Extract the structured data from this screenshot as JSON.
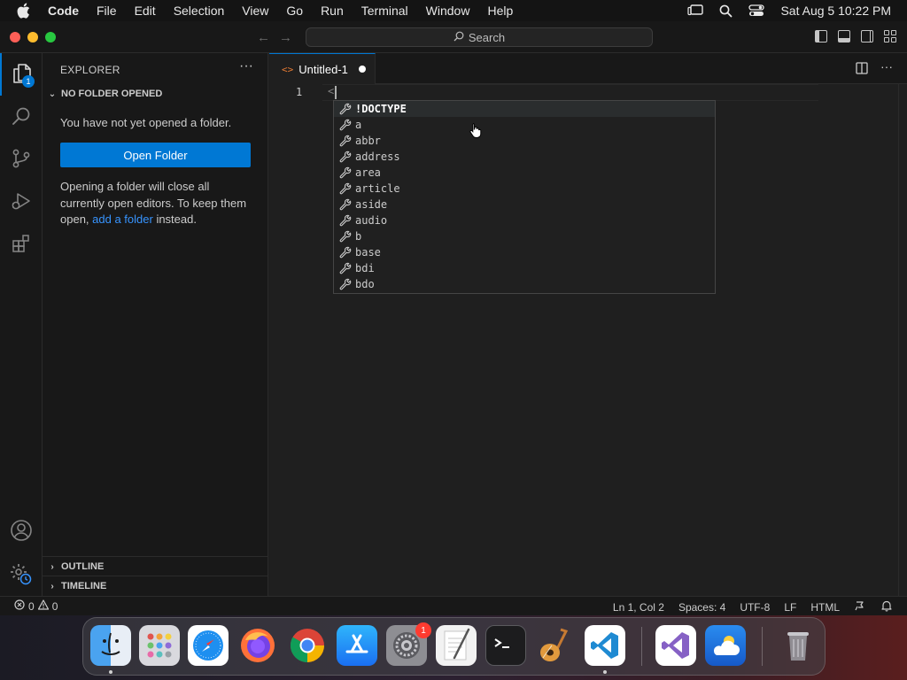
{
  "menubar": {
    "app_name": "Code",
    "items": [
      "File",
      "Edit",
      "Selection",
      "View",
      "Go",
      "Run",
      "Terminal",
      "Window",
      "Help"
    ],
    "clock": "Sat Aug 5  10:22 PM"
  },
  "titlebar": {
    "search_label": "Search"
  },
  "activitybar": {
    "explorer_badge": "1"
  },
  "sidebar": {
    "header": "EXPLORER",
    "section_title": "NO FOLDER OPENED",
    "message": "You have not yet opened a folder.",
    "open_folder_label": "Open Folder",
    "note_prefix": "Opening a folder will close all currently open editors. To keep them open, ",
    "note_link": "add a folder",
    "note_suffix": " instead.",
    "outline_label": "OUTLINE",
    "timeline_label": "TIMELINE"
  },
  "editor": {
    "tab_label": "Untitled-1",
    "line_number": "1",
    "code": "<"
  },
  "suggestions": [
    "!DOCTYPE",
    "a",
    "abbr",
    "address",
    "area",
    "article",
    "aside",
    "audio",
    "b",
    "base",
    "bdi",
    "bdo"
  ],
  "statusbar": {
    "errors": "0",
    "warnings": "0",
    "position": "Ln 1, Col 2",
    "spaces": "Spaces: 4",
    "encoding": "UTF-8",
    "eol": "LF",
    "language": "HTML"
  },
  "dock": {
    "settings_badge": "1"
  },
  "colors": {
    "accent": "#0078d4",
    "link": "#3794ff",
    "html_icon": "#e37933"
  }
}
